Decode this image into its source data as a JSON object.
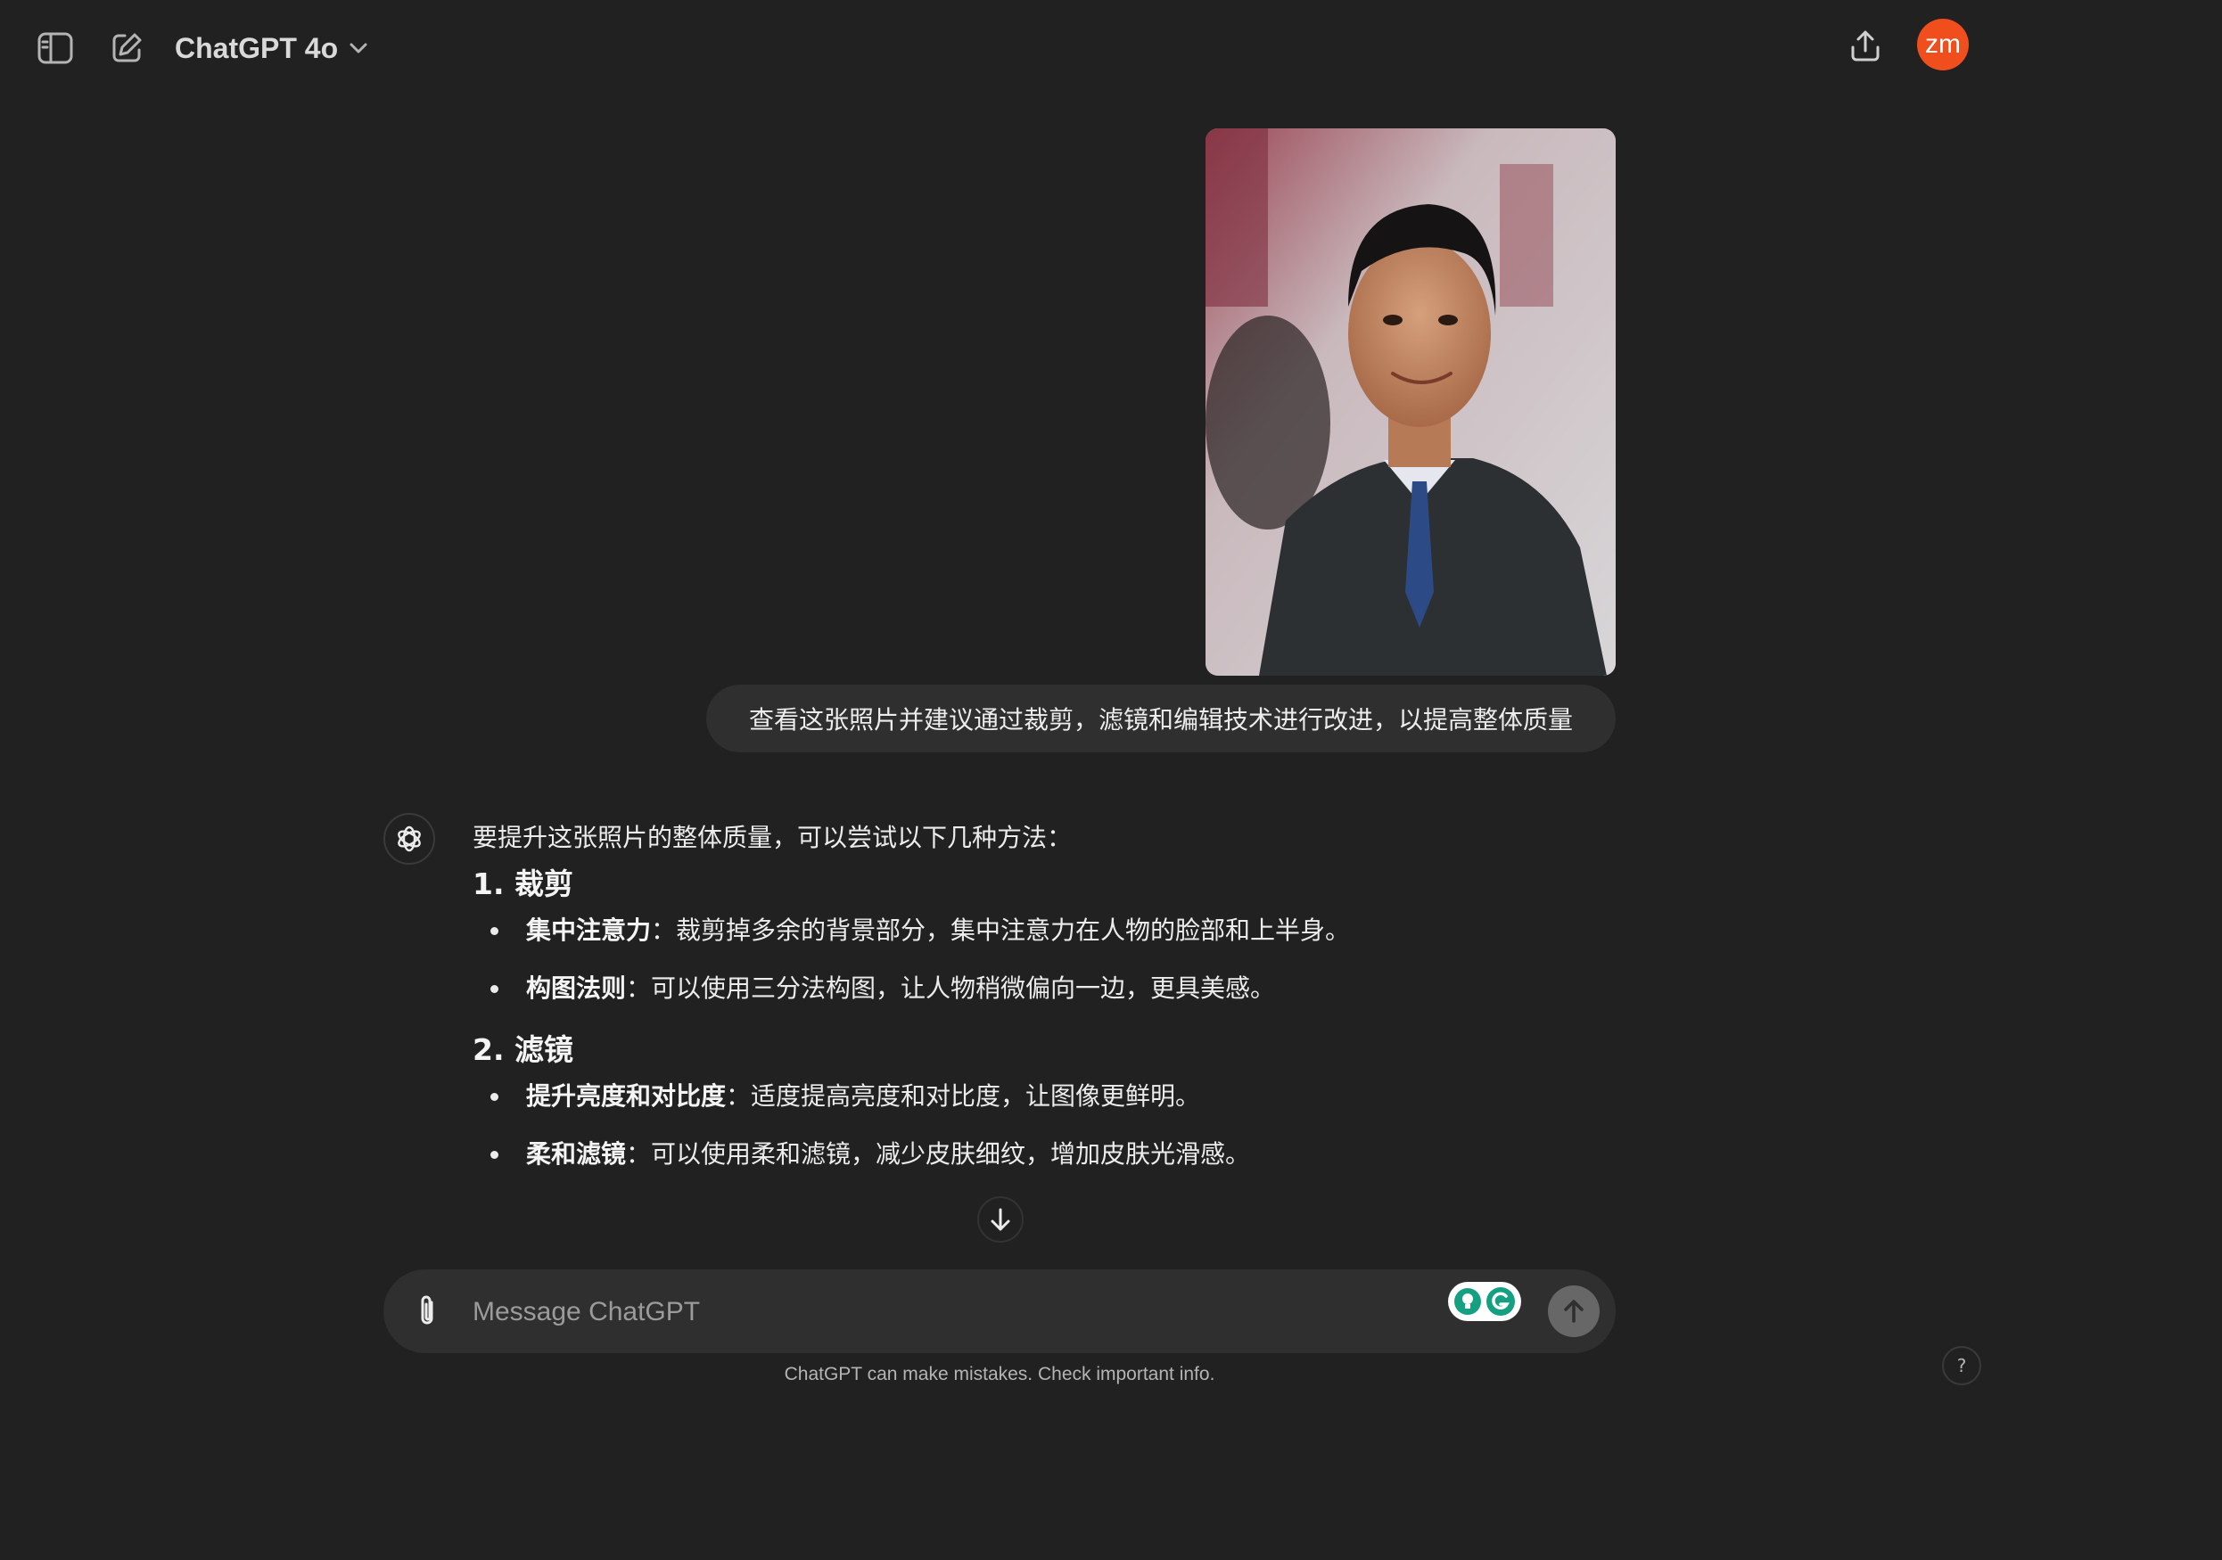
{
  "header": {
    "model_name": "ChatGPT 4o",
    "avatar_initials": "zm",
    "avatar_color": "#f04e1c"
  },
  "conversation": {
    "user_message": "查看这张照片并建议通过裁剪，滤镜和编辑技术进行改进，以提高整体质量",
    "assistant": {
      "intro": "要提升这张照片的整体质量，可以尝试以下几种方法：",
      "sections": [
        {
          "heading": "1. 裁剪",
          "items": [
            {
              "term": "集中注意力",
              "text": "：裁剪掉多余的背景部分，集中注意力在人物的脸部和上半身。"
            },
            {
              "term": "构图法则",
              "text": "：可以使用三分法构图，让人物稍微偏向一边，更具美感。"
            }
          ]
        },
        {
          "heading": "2. 滤镜",
          "items": [
            {
              "term": "提升亮度和对比度",
              "text": "：适度提高亮度和对比度，让图像更鲜明。"
            },
            {
              "term": "柔和滤镜",
              "text": "：可以使用柔和滤镜，减少皮肤细纹，增加皮肤光滑感。"
            }
          ]
        }
      ]
    }
  },
  "composer": {
    "placeholder": "Message ChatGPT"
  },
  "footer": {
    "disclaimer": "ChatGPT can make mistakes. Check important info.",
    "help_label": "?"
  },
  "icons": {
    "sidebar_toggle": "sidebar-icon",
    "new_chat": "edit-icon",
    "model_dropdown": "chevron-down-icon",
    "share": "share-icon",
    "assistant_logo": "openai-logo-icon",
    "attach": "paperclip-icon",
    "send": "arrow-up-icon",
    "scroll": "arrow-down-icon",
    "grammarly": "grammarly-icon"
  }
}
